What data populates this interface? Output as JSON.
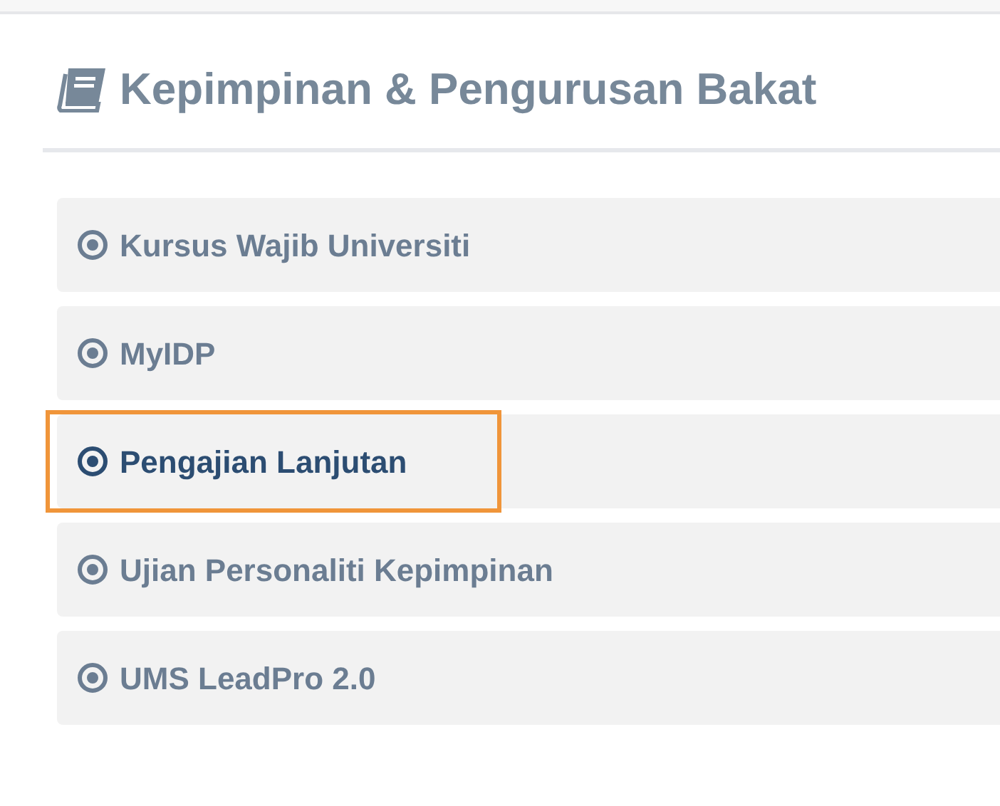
{
  "panel": {
    "title": "Kepimpinan & Pengurusan Bakat",
    "items": [
      {
        "label": "Kursus Wajib Universiti",
        "selected": false
      },
      {
        "label": "MyIDP",
        "selected": false
      },
      {
        "label": "Pengajian Lanjutan",
        "selected": true
      },
      {
        "label": "Ujian Personaliti Kepimpinan",
        "selected": false
      },
      {
        "label": "UMS LeadPro 2.0",
        "selected": false
      }
    ]
  }
}
